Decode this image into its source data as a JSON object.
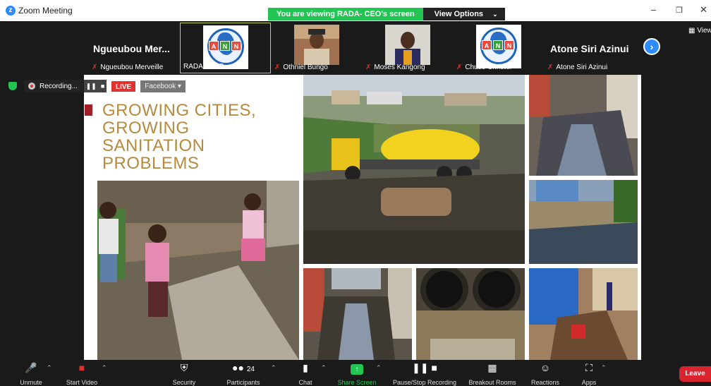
{
  "window": {
    "app_title": "Zoom Meeting",
    "share_banner": "You are viewing RADA- CEO's screen",
    "view_options": "View Options",
    "view_button": "View"
  },
  "gallery": {
    "tiles": [
      {
        "big_name": "Ngueubou  Mer...",
        "label": "Ngueubou Merveille"
      },
      {
        "label": "RADA - CEO"
      },
      {
        "label": "Othniel Bungo"
      },
      {
        "label": "Moses Kangong"
      },
      {
        "label": "Chuse Christel"
      },
      {
        "big_name": "Atone Siri Azinui",
        "label": "Atone Siri Azinui"
      }
    ],
    "logo_letters": [
      "A",
      "N",
      "N"
    ]
  },
  "recording": {
    "label": "Recording..."
  },
  "share": {
    "live_badge": "LIVE",
    "facebook_label": "Facebook",
    "slide_title": "GROWING CITIES, GROWING SANITATION PROBLEMS"
  },
  "toolbar": {
    "unmute": "Unmute",
    "start_video": "Start Video",
    "security": "Security",
    "participants": "Participants",
    "participants_count": "24",
    "chat": "Chat",
    "share_screen": "Share Screen",
    "pause_recording": "Pause/Stop Recording",
    "breakout_rooms": "Breakout Rooms",
    "reactions": "Reactions",
    "apps": "Apps",
    "leave": "Leave"
  },
  "colors": {
    "accent_green": "#23c552",
    "zoom_blue": "#2d8cff",
    "leave_red": "#d9232e",
    "slide_title_gold": "#b58a3c"
  }
}
